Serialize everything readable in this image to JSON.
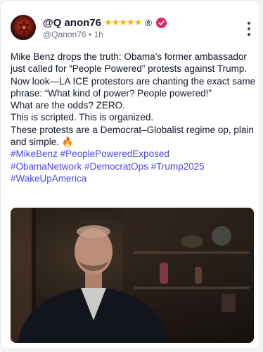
{
  "post": {
    "author": {
      "display_name": "@Q anon76",
      "stars": "★★★★★",
      "registered_mark": "®",
      "handle": "@Qanon76",
      "separator": "•",
      "time_ago": "1h"
    },
    "body_lines": [
      "Mike Benz drops the truth: Obama’s former ambassador just called for “People Powered” protests against Trump.",
      "Now look—LA ICE protestors are chanting the exact same phrase: “What kind of power? People powered!”",
      "What are the odds? ZERO.",
      "This is scripted. This is organized.",
      "These protests are a Democrat–Globalist regime op, plain and simple. 🔥"
    ],
    "hashtags": [
      "#MikeBenz",
      "#PeoplePoweredExposed",
      "#ObamaNetwork",
      "#DemocratOps",
      "#Trump2025",
      "#WakeUpAmerica"
    ]
  },
  "colors": {
    "hashtag": "#4f46e5",
    "verified_badge": "#e0245e",
    "stars": "#f5b301"
  },
  "icons": {
    "verified": "verified-badge-icon",
    "more": "more-vertical-icon"
  }
}
